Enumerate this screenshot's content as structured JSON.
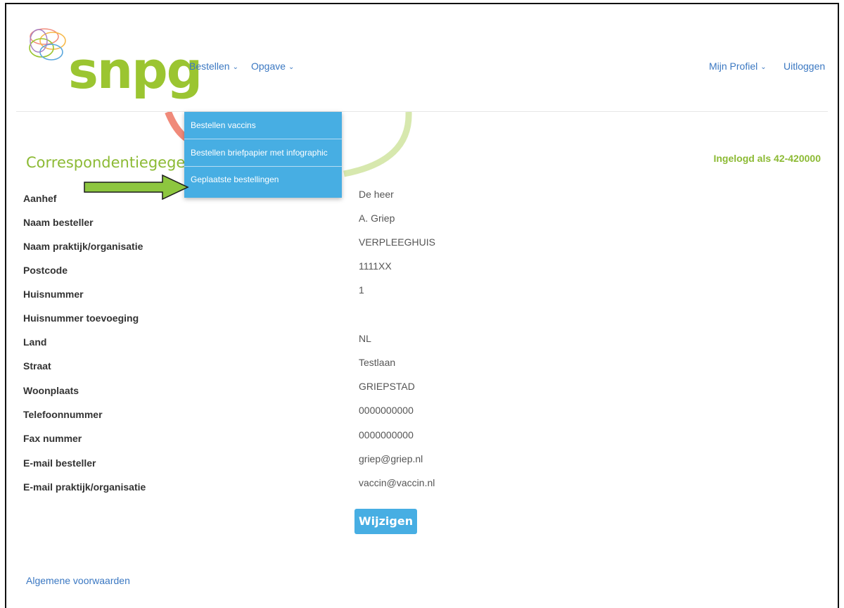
{
  "brand": {
    "name": "snpg",
    "colors": {
      "green": "#9bc531",
      "accent_blue": "#47aee3",
      "link_blue": "#3b78c2",
      "decor_red": "#f08a7a",
      "decor_lightgreen": "#d7e8ae"
    }
  },
  "nav": {
    "left": [
      {
        "label": "Bestellen",
        "icon": "chevron-down-icon"
      },
      {
        "label": "Opgave",
        "icon": "chevron-down-icon"
      }
    ],
    "right": [
      {
        "label": "Mijn Profiel",
        "icon": "chevron-down-icon"
      },
      {
        "label": "Uitloggen"
      }
    ]
  },
  "dropdown": {
    "items": [
      {
        "label": "Bestellen vaccins"
      },
      {
        "label": "Bestellen briefpapier met infographic"
      },
      {
        "label": "Geplaatste bestellingen"
      }
    ],
    "highlight_arrow": {
      "color": "#8dc63f",
      "icon": "right-arrow-icon"
    }
  },
  "page": {
    "heading": "Correspondentiegegevens",
    "logged_in": "Ingelogd als 42-420000"
  },
  "form": {
    "rows": [
      {
        "label": "Aanhef",
        "value": "De heer"
      },
      {
        "label": "Naam besteller",
        "value": "A. Griep"
      },
      {
        "label": "Naam praktijk/organisatie",
        "value": "VERPLEEGHUIS"
      },
      {
        "label": "Postcode",
        "value": "1111XX"
      },
      {
        "label": "Huisnummer",
        "value": "1"
      },
      {
        "label": "Huisnummer toevoeging",
        "value": ""
      },
      {
        "label": "Land",
        "value": "NL"
      },
      {
        "label": "Straat",
        "value": "Testlaan"
      },
      {
        "label": "Woonplaats",
        "value": "GRIEPSTAD"
      },
      {
        "label": "Telefoonnummer",
        "value": "0000000000"
      },
      {
        "label": "Fax nummer",
        "value": "0000000000"
      },
      {
        "label": "E-mail besteller",
        "value": "griep@griep.nl"
      },
      {
        "label": "E-mail praktijk/organisatie",
        "value": "vaccin@vaccin.nl"
      }
    ],
    "edit_button": "Wijzigen"
  },
  "footer": {
    "link": "Algemene voorwaarden"
  }
}
